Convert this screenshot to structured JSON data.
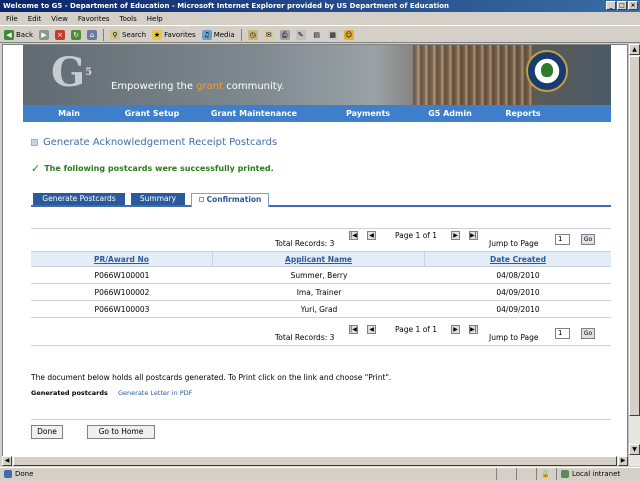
{
  "window": {
    "title": "Welcome to G5 - Department of Education - Microsoft Internet Explorer provided by US Department of Education",
    "minimize": "_",
    "maximize": "□",
    "close": "×"
  },
  "menu": [
    "File",
    "Edit",
    "View",
    "Favorites",
    "Tools",
    "Help"
  ],
  "toolbar": {
    "back": "Back",
    "search": "Search",
    "favorites": "Favorites",
    "media": "Media"
  },
  "banner": {
    "logo": "G",
    "logo_sup": "5",
    "tagline_pre": "Empowering the ",
    "tagline_hl": "grant",
    "tagline_post": " community."
  },
  "nav": [
    "Main",
    "Grant Setup",
    "Grant Maintenance",
    "Payments",
    "G5 Admin",
    "Reports"
  ],
  "page": {
    "heading": "Generate Acknowledgement Receipt Postcards",
    "success": "The following postcards were successfully printed."
  },
  "tabs": [
    "Generate Postcards",
    "Summary",
    "Confirmation"
  ],
  "pager": {
    "total_records": "Total Records: 3",
    "page_info": "Page 1 of 1",
    "jump_label": "Jump to Page",
    "jump_value": "1",
    "go": "Go",
    "first": "|◀",
    "prev": "◀",
    "next": "▶",
    "last": "▶|"
  },
  "table": {
    "headers": [
      "PR/Award No",
      "Applicant Name",
      "Date Created"
    ],
    "rows": [
      [
        "P066W100001",
        "Summer, Berry",
        "04/08/2010"
      ],
      [
        "P066W100002",
        "Ima, Trainer",
        "04/09/2010"
      ],
      [
        "P066W100003",
        "Yuri, Grad",
        "04/09/2010"
      ]
    ]
  },
  "note": "The document below holds all postcards generated. To Print click on the link and choose \"Print\".",
  "generated_label": "Generated postcards",
  "generated_link": "Generate Letter in PDF",
  "buttons": {
    "done": "Done",
    "home": "Go to Home"
  },
  "status": {
    "left": "Done",
    "zone": "Local intranet"
  }
}
